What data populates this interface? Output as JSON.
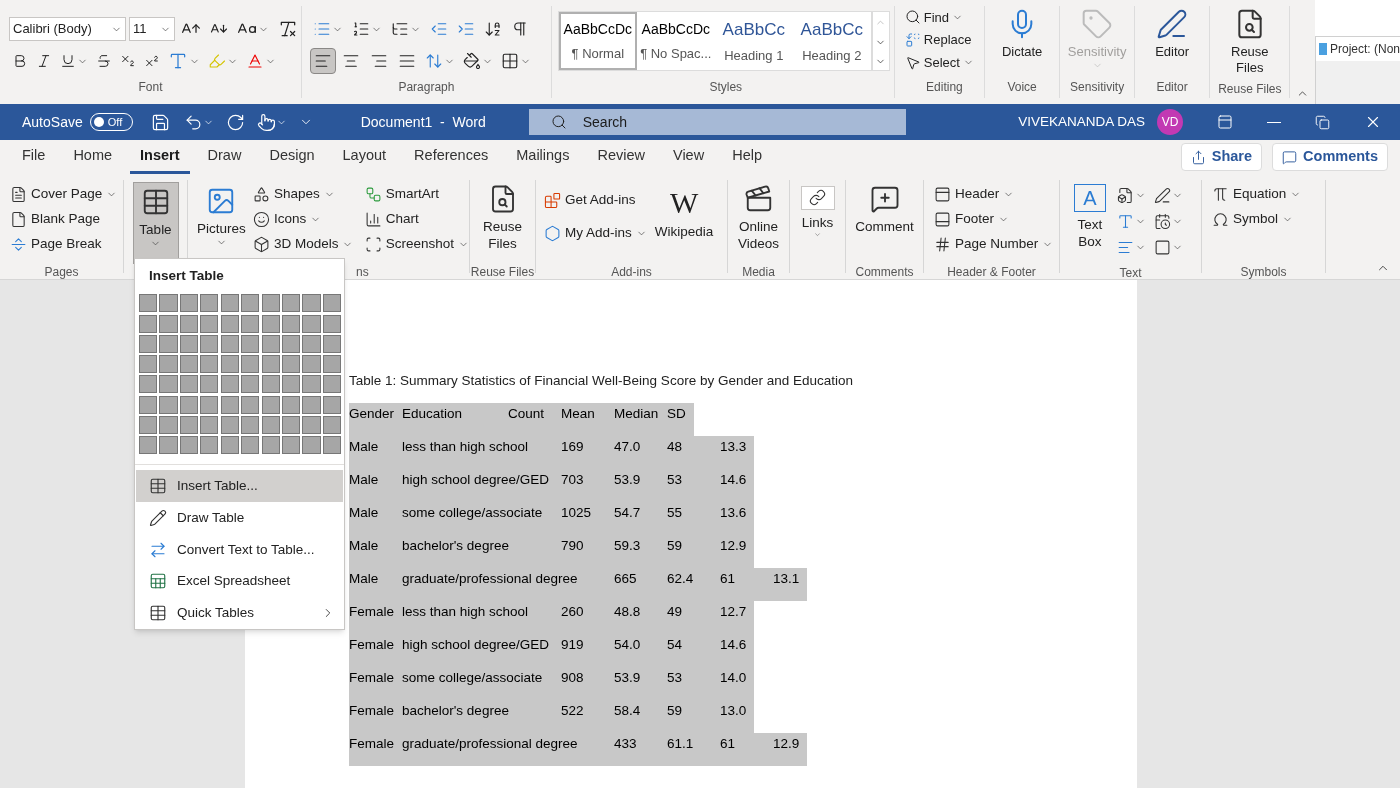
{
  "background_window": {
    "font_group": {
      "font_name": "Calibri (Body)",
      "font_size": "11",
      "label": "Font"
    },
    "paragraph_group": {
      "alignment_buttons": [
        {
          "selected": true
        },
        {
          "selected": false
        },
        {
          "selected": false
        },
        {
          "selected": false
        }
      ],
      "label": "Paragraph"
    },
    "styles_group": {
      "styles": [
        {
          "preview": "AaBbCcDc",
          "name": "¶ Normal",
          "selected": true
        },
        {
          "preview": "AaBbCcDc",
          "name": "¶ No Spac...",
          "selected": false
        },
        {
          "preview": "AaBbCc",
          "name": "Heading 1",
          "selected": false
        },
        {
          "preview": "AaBbCc",
          "name": "Heading 2",
          "selected": false
        }
      ],
      "label": "Styles"
    },
    "editing_group": {
      "items": [
        "Find",
        "Replace",
        "Select"
      ],
      "label": "Editing"
    },
    "big_buttons": [
      {
        "kind": "dictate",
        "label": "Dictate",
        "group": "Voice",
        "disabled": false
      },
      {
        "kind": "sensitivity",
        "label": "Sensitivity",
        "group": "Sensitivity",
        "disabled": true
      },
      {
        "kind": "editor",
        "label": "Editor",
        "group": "Editor",
        "disabled": false
      },
      {
        "kind": "reuse",
        "label": "Reuse Files",
        "group": "Reuse Files",
        "disabled": false
      }
    ],
    "side_window": {
      "title": "Project: (Non"
    }
  },
  "title_bar": {
    "autosave": {
      "label": "AutoSave",
      "on": false,
      "state_text": "Off"
    },
    "title": "Document1  -  Word",
    "search": {
      "placeholder": "Search"
    },
    "user": {
      "name": "VIVEKANANDA DAS",
      "initials": "VD"
    }
  },
  "tabs": [
    {
      "label": "File",
      "selected": false
    },
    {
      "label": "Home",
      "selected": false
    },
    {
      "label": "Insert",
      "selected": true
    },
    {
      "label": "Draw",
      "selected": false
    },
    {
      "label": "Design",
      "selected": false
    },
    {
      "label": "Layout",
      "selected": false
    },
    {
      "label": "References",
      "selected": false
    },
    {
      "label": "Mailings",
      "selected": false
    },
    {
      "label": "Review",
      "selected": false
    },
    {
      "label": "View",
      "selected": false
    },
    {
      "label": "Help",
      "selected": false
    }
  ],
  "share_button": "Share",
  "comments_button": "Comments",
  "insert_ribbon": {
    "pages": {
      "items": [
        "Cover Page",
        "Blank Page",
        "Page Break"
      ],
      "label": "Pages"
    },
    "table": {
      "label": "Table",
      "expanded": true
    },
    "illustrations": {
      "pictures": "Pictures",
      "items": [
        "Shapes",
        "Icons",
        "3D Models",
        "SmartArt",
        "Chart",
        "Screenshot"
      ],
      "label": "ns"
    },
    "reuse_files": {
      "button": "Reuse Files",
      "label": "Reuse Files"
    },
    "add_ins": {
      "items": [
        "Get Add-ins",
        "My Add-ins"
      ],
      "wikipedia": {
        "glyph": "W",
        "label": "Wikipedia"
      },
      "label": "Add-ins"
    },
    "media": {
      "button": "Online Videos",
      "label": "Media"
    },
    "links": {
      "button": "Links"
    },
    "comments": {
      "button": "Comment",
      "label": "Comments"
    },
    "header_footer": {
      "items": [
        "Header",
        "Footer",
        "Page Number"
      ],
      "label": "Header & Footer"
    },
    "text": {
      "text_box": {
        "glyph": "A",
        "label": "Text Box"
      },
      "label": "Text"
    },
    "symbols": {
      "items": [
        "Equation",
        "Symbol"
      ],
      "label": "Symbols"
    }
  },
  "insert_table_menu": {
    "title": "Insert Table",
    "items": [
      {
        "kind": "insert",
        "label": "Insert Table...",
        "selected": true,
        "submenu": false
      },
      {
        "kind": "draw",
        "label": "Draw Table",
        "selected": false,
        "submenu": false
      },
      {
        "kind": "convert",
        "label": "Convert Text to Table...",
        "selected": false,
        "submenu": false
      },
      {
        "kind": "excel",
        "label": "Excel Spreadsheet",
        "selected": false,
        "submenu": false
      },
      {
        "kind": "quick",
        "label": "Quick Tables",
        "selected": false,
        "submenu": true
      }
    ]
  },
  "document": {
    "caption": "Table 1: Summary Statistics of Financial Well-Being Score by Gender and Education",
    "lines": [
      "Gender\tEducation\tCount\tMean\tMedian\tSD",
      "Male\tless than high school\t169\t47.0\t48\t13.3",
      "Male\thigh school degree/GED\t703\t53.9\t53\t14.6",
      "Male\tsome college/associate\t1025\t54.7\t55\t13.6",
      "Male\tbachelor's degree\t790\t59.3\t59\t12.9",
      "Male\tgraduate/professional degree\t665\t62.4\t61\t13.1",
      "Female\tless than high school\t260\t48.8\t49\t12.7",
      "Female\thigh school degree/GED\t919\t54.0\t54\t14.6",
      "Female\tsome college/associate\t908\t53.9\t53\t14.0",
      "Female\tbachelor's degree\t522\t58.4\t59\t13.0",
      "Female\tgraduate/professional degree\t433\t61.1\t61\t12.9"
    ]
  }
}
